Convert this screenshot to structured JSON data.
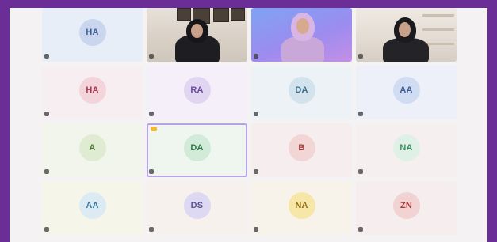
{
  "participants": [
    {
      "type": "avatar",
      "initials": "HA",
      "name": "",
      "bg": "#e8eef7",
      "circle": "#c9d6ee",
      "color": "#3e5e97"
    },
    {
      "type": "video",
      "scene": "v-wall-1",
      "name": ""
    },
    {
      "type": "video",
      "scene": "v-wall-2",
      "name": ""
    },
    {
      "type": "video",
      "scene": "v-wall-3",
      "name": ""
    },
    {
      "type": "avatar",
      "initials": "HA",
      "name": "",
      "bg": "#f6eef0",
      "circle": "#f2d4da",
      "color": "#b3334f"
    },
    {
      "type": "avatar",
      "initials": "RA",
      "name": "",
      "bg": "#f4eff8",
      "circle": "#e1d6f1",
      "color": "#6c4aa3"
    },
    {
      "type": "avatar",
      "initials": "DA",
      "name": "",
      "bg": "#edf2f6",
      "circle": "#d3e3ee",
      "color": "#3d6d8c"
    },
    {
      "type": "avatar",
      "initials": "AA",
      "name": "",
      "bg": "#edf0f8",
      "circle": "#d0dcf2",
      "color": "#3b5e99"
    },
    {
      "type": "avatar",
      "initials": "A",
      "name": "",
      "bg": "#f1f5ec",
      "circle": "#dfecd1",
      "color": "#4e7b34"
    },
    {
      "type": "avatar",
      "initials": "DA",
      "name": "",
      "bg": "#eef6ef",
      "circle": "#d2ead8",
      "color": "#2f7a48",
      "speaking": true
    },
    {
      "type": "avatar",
      "initials": "B",
      "name": "",
      "bg": "#f6eeee",
      "circle": "#f2d6d6",
      "color": "#a83a3a"
    },
    {
      "type": "avatar",
      "initials": "NA",
      "name": "",
      "bg": "#f6efef",
      "circle": "#dff0e6",
      "color": "#3b8a5c"
    },
    {
      "type": "avatar",
      "initials": "AA",
      "name": "",
      "bg": "#f6f5ea",
      "circle": "#dcebf3",
      "color": "#3b7597"
    },
    {
      "type": "avatar",
      "initials": "DS",
      "name": "",
      "bg": "#f6f1ec",
      "circle": "#ded9f2",
      "color": "#5a5396"
    },
    {
      "type": "avatar",
      "initials": "NA",
      "name": "",
      "bg": "#f7f3ea",
      "circle": "#f6e6a8",
      "color": "#8c6a10"
    },
    {
      "type": "avatar",
      "initials": "ZN",
      "name": "",
      "bg": "#f6eeee",
      "circle": "#f1d3d3",
      "color": "#a63a3a"
    }
  ]
}
